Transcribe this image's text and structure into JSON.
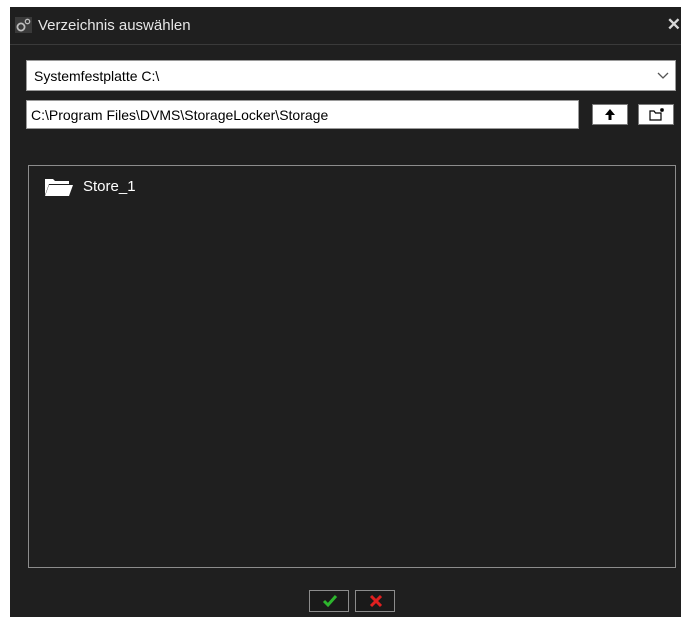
{
  "dialog": {
    "title": "Verzeichnis auswählen",
    "title_icon": "gear-icon",
    "close_icon": "close-icon"
  },
  "drive_select": {
    "value": "Systemfestplatte C:\\",
    "icon": "chevron-down-icon"
  },
  "path": {
    "value": "C:\\Program Files\\DVMS\\StorageLocker\\Storage"
  },
  "toolbar": {
    "up_icon": "arrow-up-icon",
    "new_folder_icon": "new-folder-icon"
  },
  "folders": [
    {
      "name": "Store_1",
      "icon": "folder-open-icon"
    }
  ],
  "footer": {
    "ok_icon": "checkmark-icon",
    "cancel_icon": "cross-icon"
  },
  "colors": {
    "background": "#1f1f1f",
    "ok": "#2db52d",
    "cancel": "#e02020"
  }
}
